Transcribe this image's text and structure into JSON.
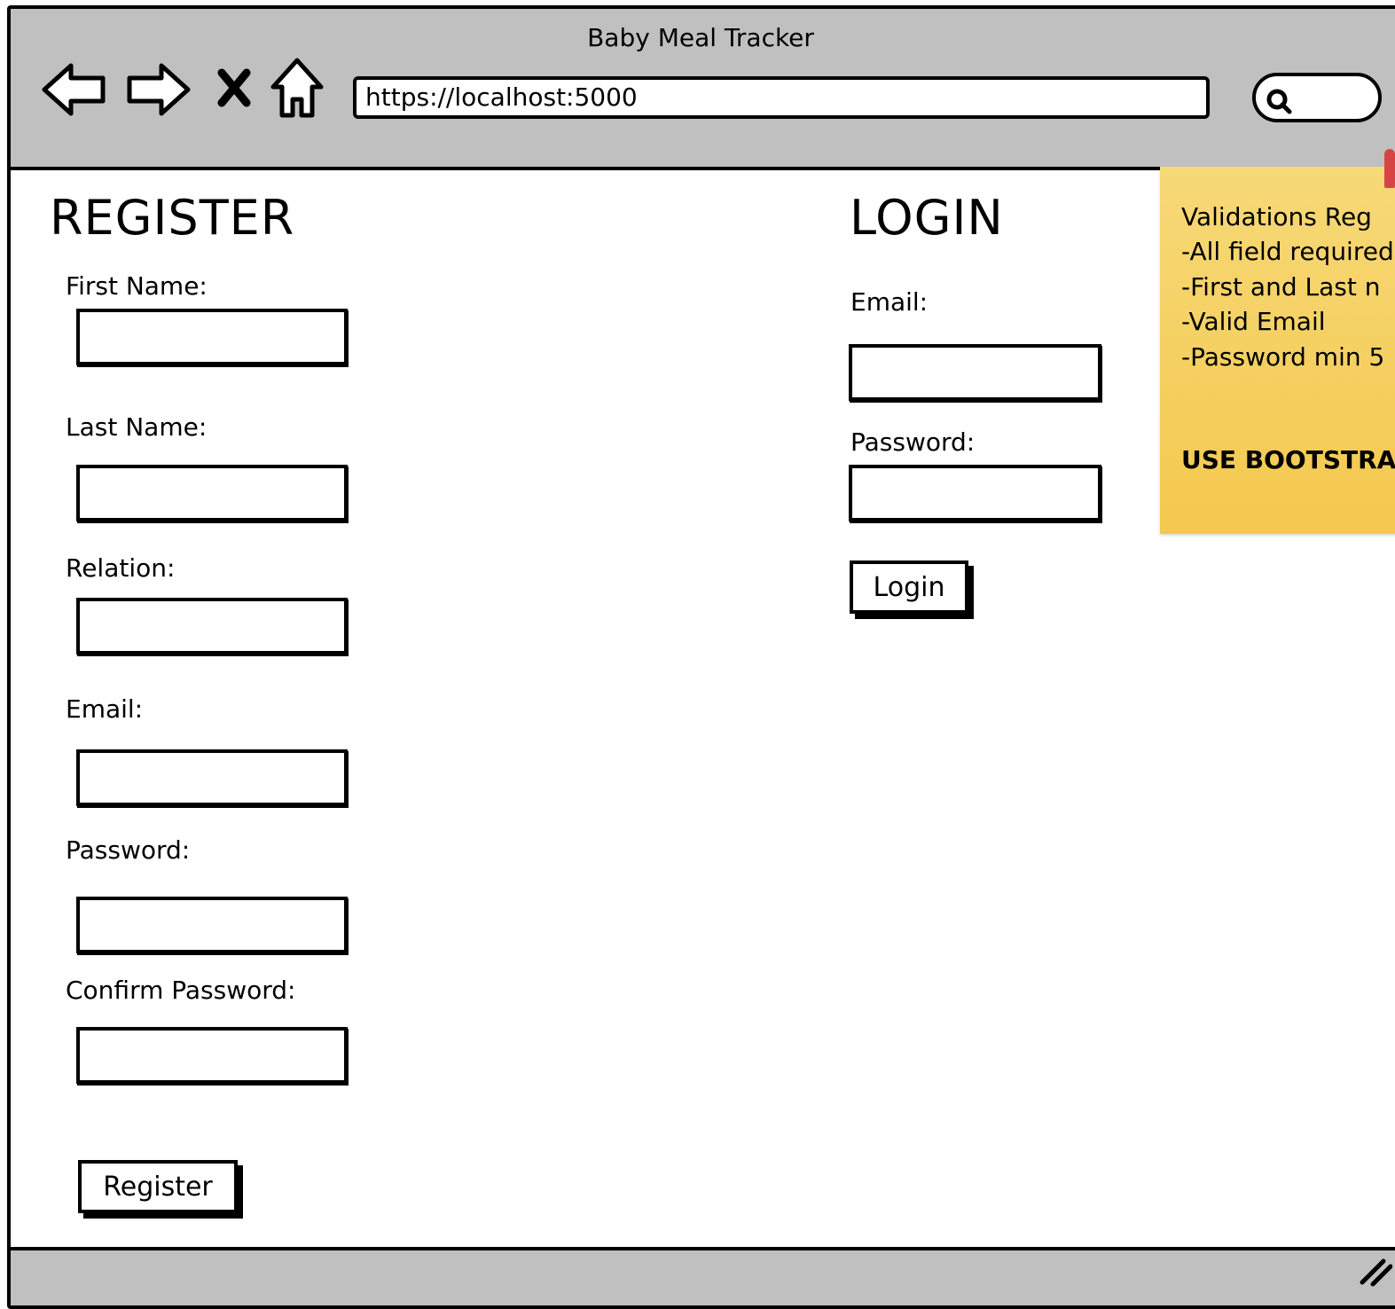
{
  "browser": {
    "title": "Baby Meal Tracker",
    "url": "https://localhost:5000",
    "nav_icons": [
      "back-arrow-icon",
      "forward-arrow-icon",
      "stop-icon",
      "home-icon"
    ],
    "search_icon": "search-icon"
  },
  "register": {
    "heading": "REGISTER",
    "fields": [
      {
        "label": "First Name:",
        "value": ""
      },
      {
        "label": "Last Name:",
        "value": ""
      },
      {
        "label": "Relation:",
        "value": ""
      },
      {
        "label": "Email:",
        "value": ""
      },
      {
        "label": "Password:",
        "value": ""
      },
      {
        "label": "Confirm Password:",
        "value": ""
      }
    ],
    "button": "Register"
  },
  "login": {
    "heading": "LOGIN",
    "fields": [
      {
        "label": "Email:",
        "value": ""
      },
      {
        "label": "Password:",
        "value": ""
      }
    ],
    "button": "Login"
  },
  "note": {
    "lines": [
      "Validations Reg",
      "-All field required",
      "-First and Last n",
      "-Valid Email",
      "-Password min 5"
    ],
    "emphasis": "USE BOOTSTRA",
    "color": "#f3c84d",
    "pin_color": "#d64545"
  }
}
